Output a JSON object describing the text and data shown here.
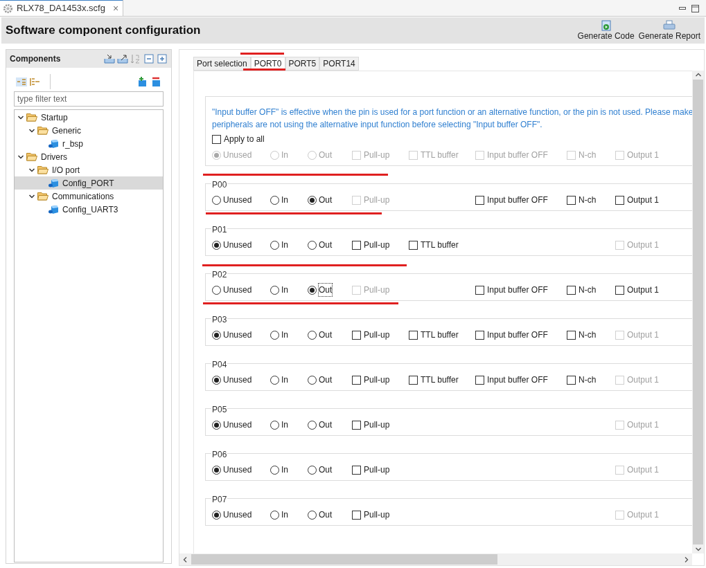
{
  "editor_tab": {
    "title": "RLX78_DA1453x.scfg",
    "close": "×"
  },
  "title_bar": {
    "title": "Software component configuration",
    "actions": [
      "Generate Code",
      "Generate Report"
    ]
  },
  "components_panel": {
    "title": "Components",
    "filter": {
      "placeholder": "type filter text"
    },
    "tree": [
      {
        "label": "Startup",
        "kind": "folder",
        "expanded": true,
        "selected": false,
        "children": [
          {
            "label": "Generic",
            "kind": "folder",
            "expanded": true,
            "selected": false,
            "children": [
              {
                "label": "r_bsp",
                "kind": "component",
                "selected": false
              }
            ]
          }
        ]
      },
      {
        "label": "Drivers",
        "kind": "folder",
        "expanded": true,
        "selected": false,
        "children": [
          {
            "label": "I/O port",
            "kind": "folder",
            "expanded": true,
            "selected": false,
            "children": [
              {
                "label": "Config_PORT",
                "kind": "component",
                "selected": true
              }
            ]
          },
          {
            "label": "Communications",
            "kind": "folder",
            "expanded": true,
            "selected": false,
            "children": [
              {
                "label": "Config_UART3",
                "kind": "component",
                "selected": false
              }
            ]
          }
        ]
      }
    ]
  },
  "tabs": [
    {
      "label": "Port selection",
      "selected": false
    },
    {
      "label": "PORT0",
      "selected": true
    },
    {
      "label": "PORT5",
      "selected": false
    },
    {
      "label": "PORT14",
      "selected": false
    }
  ],
  "info": {
    "lines": [
      "\"Input buffer OFF\" is effective when the pin is used for a port function or an alternative function, or the pin is not used. Please make",
      "peripherals are not using the alternative input function before selecting \"Input buffer OFF\"."
    ],
    "apply_to_all": {
      "label": "Apply to all",
      "checked": false
    },
    "options": {
      "unused": {
        "kind": "radio",
        "label": "Unused",
        "selected": true,
        "disabled": true
      },
      "in": {
        "kind": "radio",
        "label": "In",
        "selected": false,
        "disabled": true
      },
      "out": {
        "kind": "radio",
        "label": "Out",
        "selected": false,
        "disabled": true
      },
      "pull_up": {
        "kind": "checkbox",
        "label": "Pull-up",
        "checked": false,
        "disabled": true
      },
      "ttl_buffer": {
        "kind": "checkbox",
        "label": "TTL buffer",
        "checked": false,
        "disabled": true
      },
      "input_buffer_off": {
        "kind": "checkbox",
        "label": "Input buffer OFF",
        "checked": false,
        "disabled": true
      },
      "n_ch": {
        "kind": "checkbox",
        "label": "N-ch",
        "checked": false,
        "disabled": true
      },
      "output_1": {
        "kind": "checkbox",
        "label": "Output 1",
        "checked": false,
        "disabled": true
      }
    }
  },
  "pins": [
    {
      "name": "P00",
      "options": {
        "unused": {
          "kind": "radio",
          "label": "Unused",
          "selected": false,
          "disabled": false,
          "focused": false
        },
        "in": {
          "kind": "radio",
          "label": "In",
          "selected": false,
          "disabled": false,
          "focused": false
        },
        "out": {
          "kind": "radio",
          "label": "Out",
          "selected": true,
          "disabled": false,
          "focused": false
        },
        "pull_up": {
          "kind": "checkbox",
          "label": "Pull-up",
          "checked": false,
          "disabled": true
        },
        "input_buffer_off": {
          "kind": "checkbox",
          "label": "Input buffer OFF",
          "checked": false,
          "disabled": false
        },
        "n_ch": {
          "kind": "checkbox",
          "label": "N-ch",
          "checked": false,
          "disabled": false
        },
        "output_1": {
          "kind": "checkbox",
          "label": "Output 1",
          "checked": false,
          "disabled": false
        }
      }
    },
    {
      "name": "P01",
      "options": {
        "unused": {
          "kind": "radio",
          "label": "Unused",
          "selected": true,
          "disabled": false,
          "focused": false
        },
        "in": {
          "kind": "radio",
          "label": "In",
          "selected": false,
          "disabled": false,
          "focused": false
        },
        "out": {
          "kind": "radio",
          "label": "Out",
          "selected": false,
          "disabled": false,
          "focused": false
        },
        "pull_up": {
          "kind": "checkbox",
          "label": "Pull-up",
          "checked": false,
          "disabled": false
        },
        "ttl_buffer": {
          "kind": "checkbox",
          "label": "TTL buffer",
          "checked": false,
          "disabled": false
        },
        "output_1": {
          "kind": "checkbox",
          "label": "Output 1",
          "checked": false,
          "disabled": true
        }
      }
    },
    {
      "name": "P02",
      "options": {
        "unused": {
          "kind": "radio",
          "label": "Unused",
          "selected": false,
          "disabled": false,
          "focused": false
        },
        "in": {
          "kind": "radio",
          "label": "In",
          "selected": false,
          "disabled": false,
          "focused": false
        },
        "out": {
          "kind": "radio",
          "label": "Out",
          "selected": true,
          "disabled": false,
          "focused": true
        },
        "pull_up": {
          "kind": "checkbox",
          "label": "Pull-up",
          "checked": false,
          "disabled": true
        },
        "input_buffer_off": {
          "kind": "checkbox",
          "label": "Input buffer OFF",
          "checked": false,
          "disabled": false
        },
        "n_ch": {
          "kind": "checkbox",
          "label": "N-ch",
          "checked": false,
          "disabled": false
        },
        "output_1": {
          "kind": "checkbox",
          "label": "Output 1",
          "checked": false,
          "disabled": false
        }
      }
    },
    {
      "name": "P03",
      "options": {
        "unused": {
          "kind": "radio",
          "label": "Unused",
          "selected": true,
          "disabled": false,
          "focused": false
        },
        "in": {
          "kind": "radio",
          "label": "In",
          "selected": false,
          "disabled": false,
          "focused": false
        },
        "out": {
          "kind": "radio",
          "label": "Out",
          "selected": false,
          "disabled": false,
          "focused": false
        },
        "pull_up": {
          "kind": "checkbox",
          "label": "Pull-up",
          "checked": false,
          "disabled": false
        },
        "ttl_buffer": {
          "kind": "checkbox",
          "label": "TTL buffer",
          "checked": false,
          "disabled": false
        },
        "input_buffer_off": {
          "kind": "checkbox",
          "label": "Input buffer OFF",
          "checked": false,
          "disabled": false
        },
        "n_ch": {
          "kind": "checkbox",
          "label": "N-ch",
          "checked": false,
          "disabled": false
        },
        "output_1": {
          "kind": "checkbox",
          "label": "Output 1",
          "checked": false,
          "disabled": true
        }
      }
    },
    {
      "name": "P04",
      "options": {
        "unused": {
          "kind": "radio",
          "label": "Unused",
          "selected": true,
          "disabled": false,
          "focused": false
        },
        "in": {
          "kind": "radio",
          "label": "In",
          "selected": false,
          "disabled": false,
          "focused": false
        },
        "out": {
          "kind": "radio",
          "label": "Out",
          "selected": false,
          "disabled": false,
          "focused": false
        },
        "pull_up": {
          "kind": "checkbox",
          "label": "Pull-up",
          "checked": false,
          "disabled": false
        },
        "ttl_buffer": {
          "kind": "checkbox",
          "label": "TTL buffer",
          "checked": false,
          "disabled": false
        },
        "input_buffer_off": {
          "kind": "checkbox",
          "label": "Input buffer OFF",
          "checked": false,
          "disabled": false
        },
        "n_ch": {
          "kind": "checkbox",
          "label": "N-ch",
          "checked": false,
          "disabled": false
        },
        "output_1": {
          "kind": "checkbox",
          "label": "Output 1",
          "checked": false,
          "disabled": true
        }
      }
    },
    {
      "name": "P05",
      "options": {
        "unused": {
          "kind": "radio",
          "label": "Unused",
          "selected": true,
          "disabled": false,
          "focused": false
        },
        "in": {
          "kind": "radio",
          "label": "In",
          "selected": false,
          "disabled": false,
          "focused": false
        },
        "out": {
          "kind": "radio",
          "label": "Out",
          "selected": false,
          "disabled": false,
          "focused": false
        },
        "pull_up": {
          "kind": "checkbox",
          "label": "Pull-up",
          "checked": false,
          "disabled": false
        },
        "output_1": {
          "kind": "checkbox",
          "label": "Output 1",
          "checked": false,
          "disabled": true
        }
      }
    },
    {
      "name": "P06",
      "options": {
        "unused": {
          "kind": "radio",
          "label": "Unused",
          "selected": true,
          "disabled": false,
          "focused": false
        },
        "in": {
          "kind": "radio",
          "label": "In",
          "selected": false,
          "disabled": false,
          "focused": false
        },
        "out": {
          "kind": "radio",
          "label": "Out",
          "selected": false,
          "disabled": false,
          "focused": false
        },
        "pull_up": {
          "kind": "checkbox",
          "label": "Pull-up",
          "checked": false,
          "disabled": false
        },
        "output_1": {
          "kind": "checkbox",
          "label": "Output 1",
          "checked": false,
          "disabled": true
        }
      }
    },
    {
      "name": "P07",
      "options": {
        "unused": {
          "kind": "radio",
          "label": "Unused",
          "selected": true,
          "disabled": false,
          "focused": false
        },
        "in": {
          "kind": "radio",
          "label": "In",
          "selected": false,
          "disabled": false,
          "focused": false
        },
        "out": {
          "kind": "radio",
          "label": "Out",
          "selected": false,
          "disabled": false,
          "focused": false
        },
        "pull_up": {
          "kind": "checkbox",
          "label": "Pull-up",
          "checked": false,
          "disabled": false
        },
        "output_1": {
          "kind": "checkbox",
          "label": "Output 1",
          "checked": false,
          "disabled": true
        }
      }
    }
  ]
}
